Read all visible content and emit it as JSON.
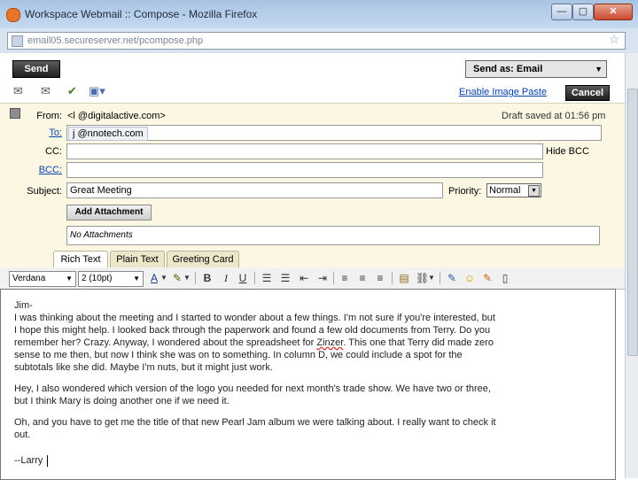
{
  "window": {
    "title": "Workspace Webmail :: Compose - Mozilla Firefox"
  },
  "urlbar": {
    "url": "email05.secureserver.net/pcompose.php"
  },
  "toolbar": {
    "send_label": "Send",
    "send_as_label": "Send as: Email",
    "enable_paste_label": "Enable Image Paste",
    "cancel_label": "Cancel"
  },
  "header": {
    "from_label": "From:",
    "from_value": "<l          @digitalactive.com>",
    "draft_status": "Draft saved at 01:56 pm",
    "to_label": "To:",
    "to_value": "j        @nnotech.com",
    "cc_label": "CC:",
    "hide_bcc_label": "Hide BCC",
    "bcc_label": "BCC:",
    "subject_label": "Subject:",
    "subject_value": "Great Meeting",
    "priority_label": "Priority:",
    "priority_value": "Normal",
    "add_attachment_label": "Add Attachment",
    "attachments_text": "No Attachments"
  },
  "tabs": [
    {
      "label": "Rich Text"
    },
    {
      "label": "Plain Text"
    },
    {
      "label": "Greeting Card"
    }
  ],
  "format": {
    "font": "Verdana",
    "size": "2 (10pt)"
  },
  "body_lines": [
    "Jim-",
    "I was thinking about the meeting and I started to wonder about a few things.  I'm not sure if you're interested, but",
    "I hope this might help.  I looked back through the paperwork and found a few old documents from Terry.  Do you",
    "remember her?  Crazy.  Anyway, I wondered about the spreadsheet for ",
    "sense to me then, but now I think she was on to something.  In column D, we could include a spot for the",
    "subtotals like she did.  Maybe I'm nuts, but it might just work.",
    "Hey, I also wondered which version of the logo you needed for next month's trade show.  We have two or three,",
    "but I think Mary is doing another one if we need it.",
    "Oh, and you have to get me the title of that new Pearl Jam album we were talking about.  I really want to check it",
    "out.",
    "--Larry"
  ],
  "body_special": {
    "misspelled": "Zinzer",
    "line4_tail": ".  This one that Terry did made zero"
  }
}
